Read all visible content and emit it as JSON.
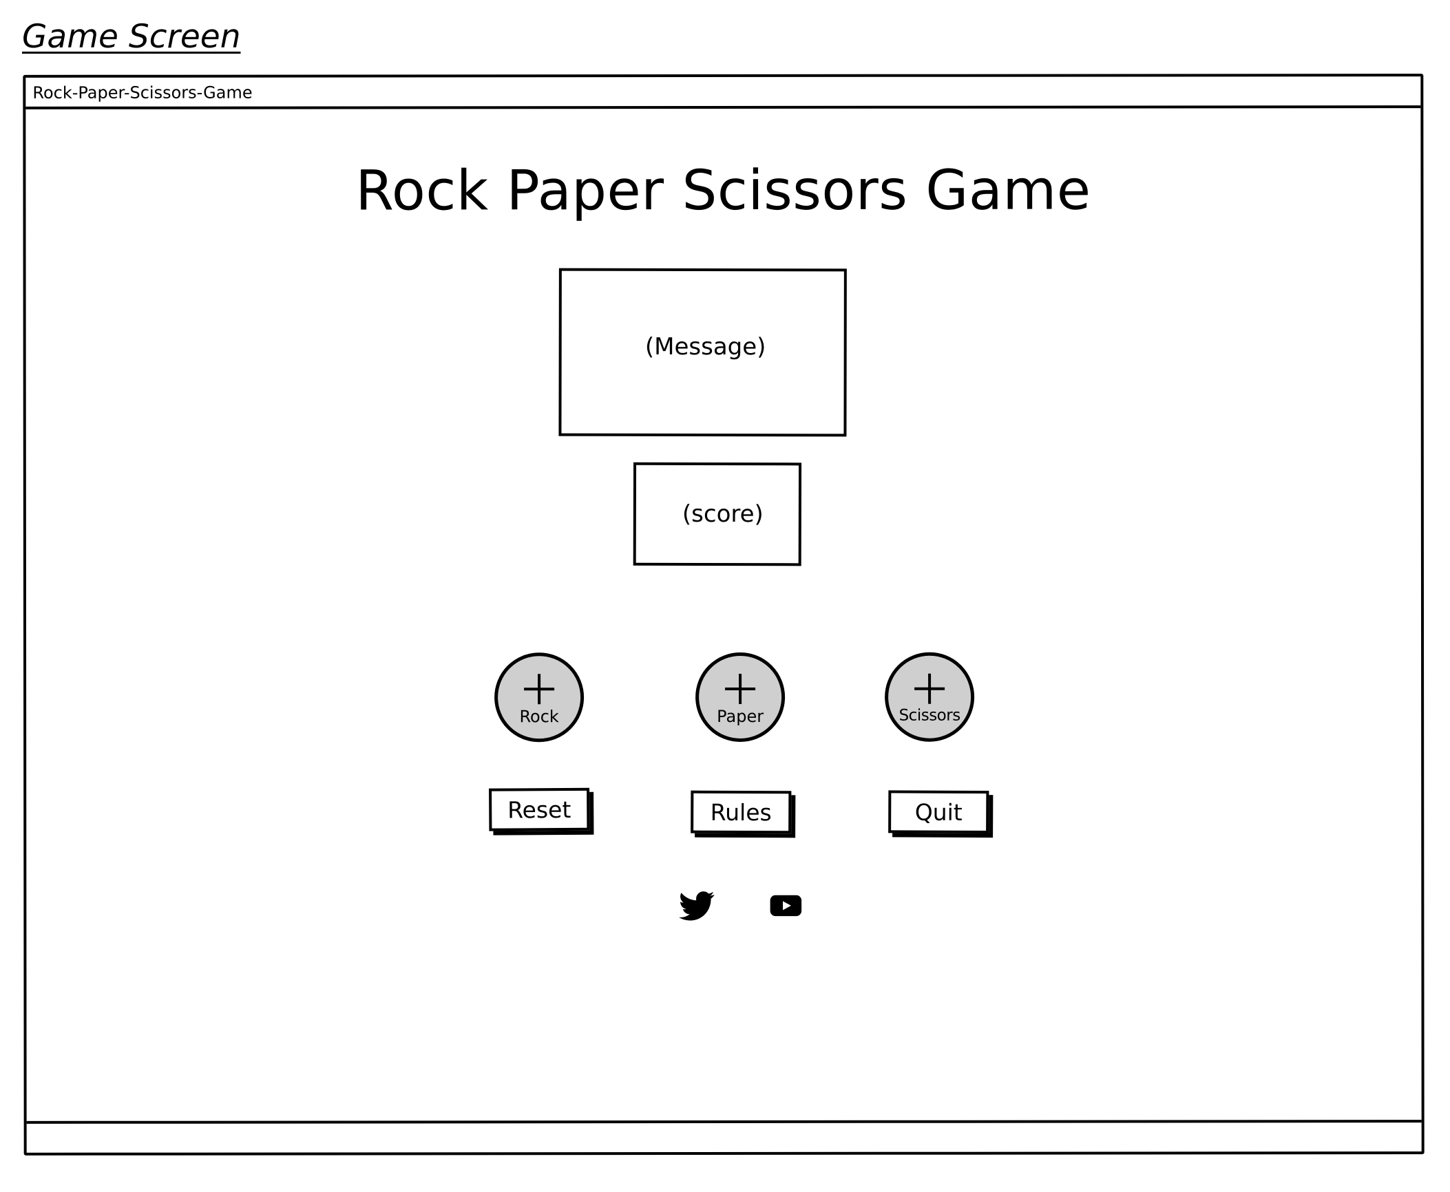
{
  "page_label": "Game Screen",
  "window": {
    "title": "Rock-Paper-Scissors-Game"
  },
  "main": {
    "heading": "Rock Paper Scissors Game",
    "message_placeholder": "(Message)",
    "score_placeholder": "(score)"
  },
  "choices": [
    {
      "label": "Rock",
      "icon": "plus-icon"
    },
    {
      "label": "Paper",
      "icon": "plus-icon"
    },
    {
      "label": "Scissors",
      "icon": "plus-icon"
    }
  ],
  "buttons": {
    "reset": "Reset",
    "rules": "Rules",
    "quit": "Quit"
  },
  "social": [
    {
      "icon": "twitter-icon"
    },
    {
      "icon": "youtube-icon"
    }
  ],
  "colors": {
    "choice_fill": "#cfcfcf",
    "stroke": "#000000",
    "background": "#ffffff"
  }
}
